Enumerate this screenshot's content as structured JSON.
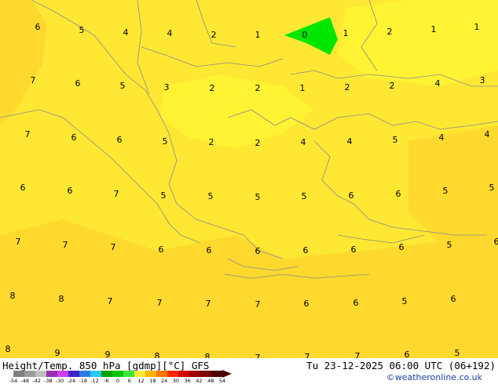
{
  "title": {
    "left": "Height/Temp. 850 hPa [gdmp][°C] GFS",
    "right": "Tu 23-12-2025 06:00 UTC (06+192)"
  },
  "credit": "©weatheronline.co.uk",
  "colors": {
    "field_main": "#ffe833",
    "field_warm": "#ffd92e",
    "field_light": "#fff333",
    "coast": "#8c8c8c",
    "cold_patch": "#00e600",
    "credit": "#1a3fa0"
  },
  "colorbar": {
    "ticks": [
      "-54",
      "-48",
      "-42",
      "-38",
      "-30",
      "-24",
      "-18",
      "-12",
      "-6",
      "0",
      "6",
      "12",
      "18",
      "24",
      "30",
      "36",
      "42",
      "48",
      "54"
    ],
    "colors": [
      "#7f7f7f",
      "#9b9b9b",
      "#bfbfbf",
      "#9a2fb5",
      "#d23cf0",
      "#3c28c8",
      "#2a7de0",
      "#28c8f0",
      "#00a000",
      "#00c800",
      "#3ce63c",
      "#ffe833",
      "#ffb400",
      "#ff7800",
      "#ff2800",
      "#d20000",
      "#a00000",
      "#7a0000",
      "#500000"
    ]
  },
  "labels": [
    "6",
    "5",
    "4",
    "4",
    "2",
    "1",
    "0",
    "1",
    "2",
    "1",
    "1",
    "7",
    "6",
    "5",
    "3",
    "2",
    "2",
    "1",
    "2",
    "2",
    "4",
    "3",
    "7",
    "6",
    "6",
    "5",
    "2",
    "2",
    "4",
    "4",
    "5",
    "4",
    "4",
    "6",
    "6",
    "7",
    "5",
    "5",
    "5",
    "5",
    "6",
    "6",
    "5",
    "5",
    "7",
    "7",
    "7",
    "6",
    "6",
    "6",
    "6",
    "6",
    "6",
    "5",
    "6",
    "8",
    "8",
    "7",
    "7",
    "7",
    "7",
    "6",
    "6",
    "5",
    "6",
    "8",
    "9",
    "9",
    "8",
    "8",
    "7",
    "7",
    "7",
    "6",
    "5"
  ]
}
